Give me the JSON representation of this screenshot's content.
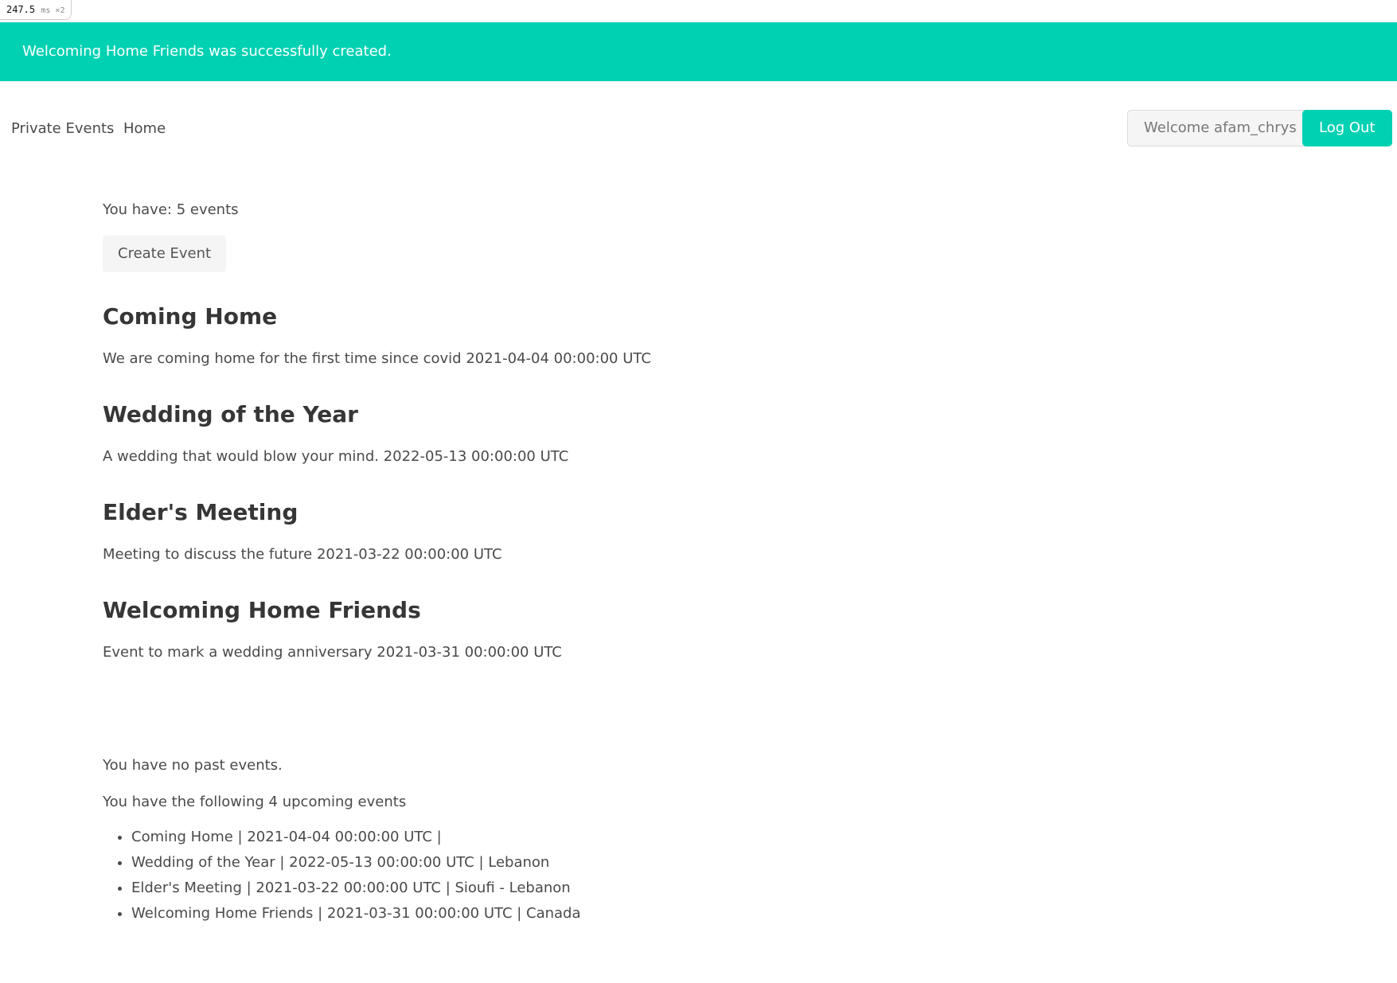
{
  "debug": {
    "timing": "247.5",
    "unit": "ms ×2"
  },
  "flash": {
    "message": "Welcoming Home Friends was successfully created."
  },
  "nav": {
    "brand": "Private Events",
    "home": "Home",
    "welcome": "Welcome afam_chrys",
    "logout": "Log Out"
  },
  "summary": {
    "count_text": "You have: 5 events",
    "create_label": "Create Event"
  },
  "events": [
    {
      "title": "Coming Home",
      "description": "We are coming home for the first time since covid 2021-04-04 00:00:00 UTC"
    },
    {
      "title": "Wedding of the Year",
      "description": "A wedding that would blow your mind. 2022-05-13 00:00:00 UTC"
    },
    {
      "title": "Elder's Meeting",
      "description": "Meeting to discuss the future 2021-03-22 00:00:00 UTC"
    },
    {
      "title": "Welcoming Home Friends",
      "description": "Event to mark a wedding anniversary 2021-03-31 00:00:00 UTC"
    }
  ],
  "past": {
    "text": "You have no past events."
  },
  "upcoming": {
    "text": "You have the following 4 upcoming events",
    "items": [
      "Coming Home | 2021-04-04 00:00:00 UTC |",
      "Wedding of the Year | 2022-05-13 00:00:00 UTC | Lebanon",
      "Elder's Meeting | 2021-03-22 00:00:00 UTC | Sioufi - Lebanon",
      "Welcoming Home Friends | 2021-03-31 00:00:00 UTC | Canada"
    ]
  },
  "colors": {
    "primary": "#00d1b2",
    "text": "#4a4a4a",
    "heading": "#363636"
  }
}
